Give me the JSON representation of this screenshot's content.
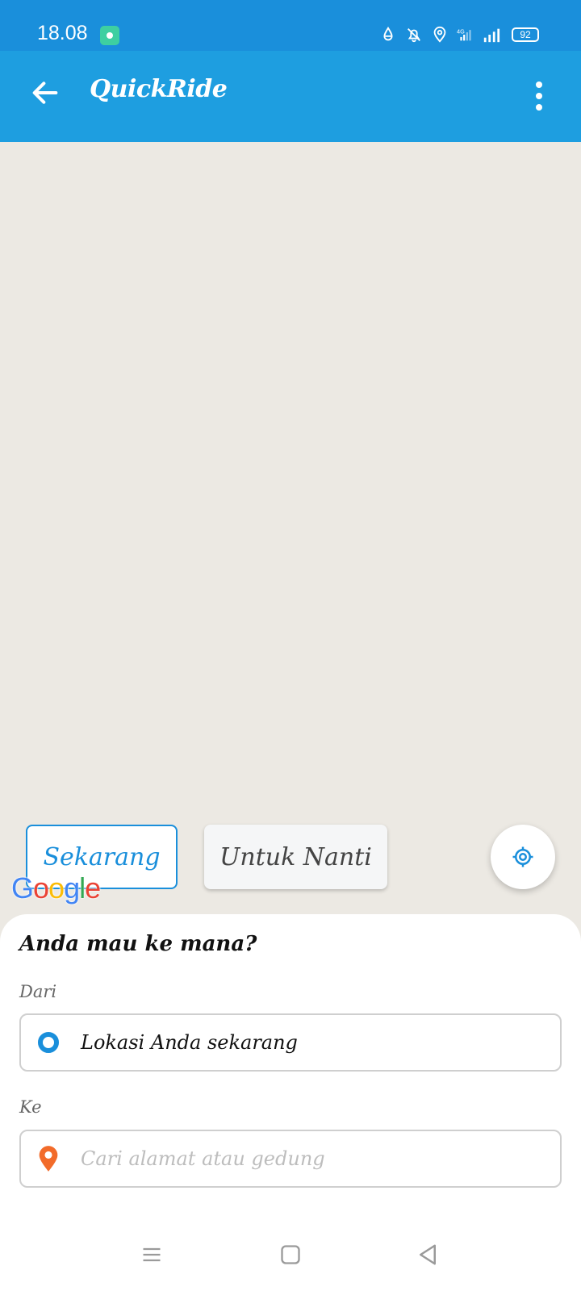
{
  "status_bar": {
    "time": "18.08",
    "battery": "92",
    "network": "4G",
    "icons": [
      "app-notification-icon",
      "data-saver-icon",
      "notifications-off-icon",
      "location-icon",
      "mobile-data-icon",
      "signal-icon",
      "battery-icon"
    ]
  },
  "app_bar": {
    "title": "QuickRide",
    "back_icon": "arrow-left-icon",
    "menu_icon": "more-vertical-icon",
    "color": "#1E9EE0"
  },
  "map": {
    "attribution": "Google",
    "time_options": [
      {
        "label": "Sekarang",
        "selected": true
      },
      {
        "label": "Untuk Nanti",
        "selected": false
      }
    ],
    "locate_icon": "my-location-icon"
  },
  "booking_sheet": {
    "title": "Anda mau ke mana?",
    "from": {
      "label": "Dari",
      "value": "Lokasi Anda sekarang",
      "icon": "origin-dot-icon"
    },
    "to": {
      "label": "Ke",
      "placeholder": "Cari alamat atau gedung",
      "icon": "destination-pin-icon"
    }
  },
  "nav_bar": {
    "buttons": [
      "recents-icon",
      "home-icon",
      "back-triangle-icon"
    ]
  },
  "colors": {
    "accent": "#1A8FDB",
    "destination": "#F26B2A",
    "map_bg": "#ECE9E3"
  }
}
